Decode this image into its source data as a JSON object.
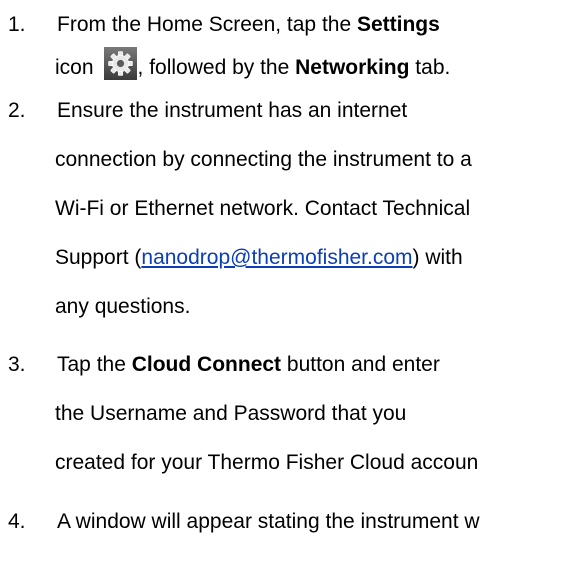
{
  "steps": [
    {
      "number": "1.",
      "line1": {
        "before": "From the Home Screen, tap the ",
        "bold": "Settings"
      },
      "line2": {
        "prefix": "icon",
        "icon": "gear-icon",
        "middle": ", followed by the ",
        "bold": "Networking",
        "suffix": " tab."
      }
    },
    {
      "number": "2.",
      "line1": "Ensure the instrument has an internet",
      "line2": "connection by connecting the instrument to a",
      "line3": "Wi-Fi or Ethernet network. Contact Technical",
      "line4": {
        "before": "Support (",
        "link": "nanodrop@thermofisher.com",
        "after": ") with"
      },
      "line5": "any questions."
    },
    {
      "number": "3.",
      "line1": {
        "before": "Tap the ",
        "bold": "Cloud Connect",
        "after": " button and enter"
      },
      "line2": "the Username and Password that you",
      "line3": "created for your Thermo Fisher Cloud accoun"
    },
    {
      "number": "4.",
      "line1": "A window will appear stating the instrument w"
    }
  ],
  "colors": {
    "link": "#0b3eb7",
    "icon_bg": "#5a5a5a"
  }
}
